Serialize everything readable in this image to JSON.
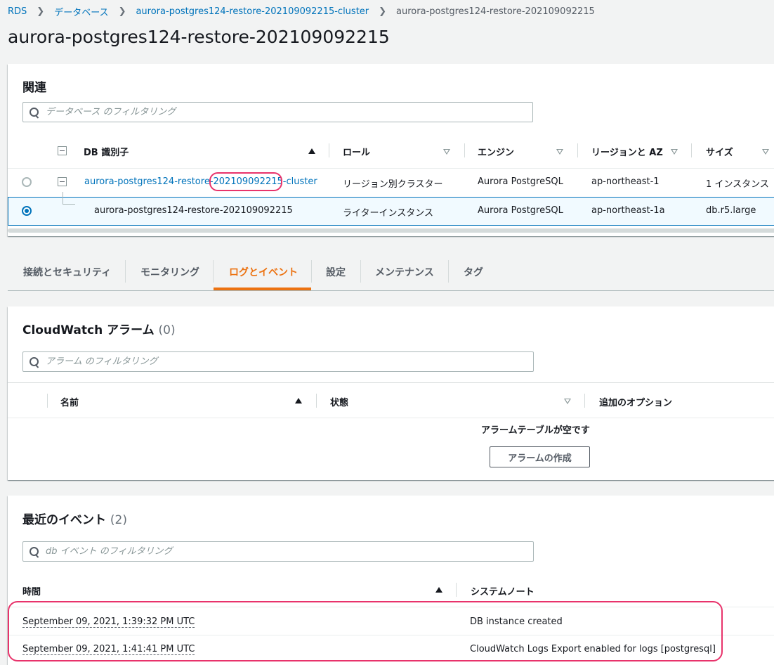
{
  "breadcrumb": {
    "rds": "RDS",
    "databases": "データベース",
    "cluster": "aurora-postgres124-restore-202109092215-cluster",
    "current": "aurora-postgres124-restore-202109092215"
  },
  "page_title": "aurora-postgres124-restore-202109092215",
  "related": {
    "title": "関連",
    "filter_placeholder": "データベース のフィルタリング",
    "columns": {
      "db_id": "DB 識別子",
      "role": "ロール",
      "engine": "エンジン",
      "region": "リージョンと AZ",
      "size": "サイズ"
    },
    "rows": [
      {
        "id_prefix": "aurora-postgres124-restore-",
        "id_highlight": "202109092215",
        "id_suffix": "-cluster",
        "role": "リージョン別クラスター",
        "engine": "Aurora PostgreSQL",
        "region": "ap-northeast-1",
        "size": "1 インスタンス",
        "selected": false
      },
      {
        "id": "aurora-postgres124-restore-202109092215",
        "role": "ライターインスタンス",
        "engine": "Aurora PostgreSQL",
        "region": "ap-northeast-1a",
        "size": "db.r5.large",
        "selected": true
      }
    ]
  },
  "tabs": [
    {
      "label": "接続とセキュリティ"
    },
    {
      "label": "モニタリング"
    },
    {
      "label": "ログとイベント",
      "active": true
    },
    {
      "label": "設定"
    },
    {
      "label": "メンテナンス"
    },
    {
      "label": "タグ"
    }
  ],
  "alarms": {
    "title": "CloudWatch アラーム",
    "count": "(0)",
    "filter_placeholder": "アラーム のフィルタリング",
    "columns": {
      "name": "名前",
      "state": "状態",
      "options": "追加のオプション"
    },
    "empty_text": "アラームテーブルが空です",
    "create_button": "アラームの作成"
  },
  "events": {
    "title": "最近のイベント",
    "count": "(2)",
    "filter_placeholder": "db イベント のフィルタリング",
    "columns": {
      "time": "時間",
      "note": "システムノート"
    },
    "rows": [
      {
        "time": "September 09, 2021, 1:39:32 PM UTC",
        "note": "DB instance created"
      },
      {
        "time": "September 09, 2021, 1:41:41 PM UTC",
        "note": "CloudWatch Logs Export enabled for logs [postgresql]"
      }
    ]
  },
  "colors": {
    "link": "#0073bb",
    "active_tab": "#ec7211",
    "highlight": "#e8336b"
  }
}
